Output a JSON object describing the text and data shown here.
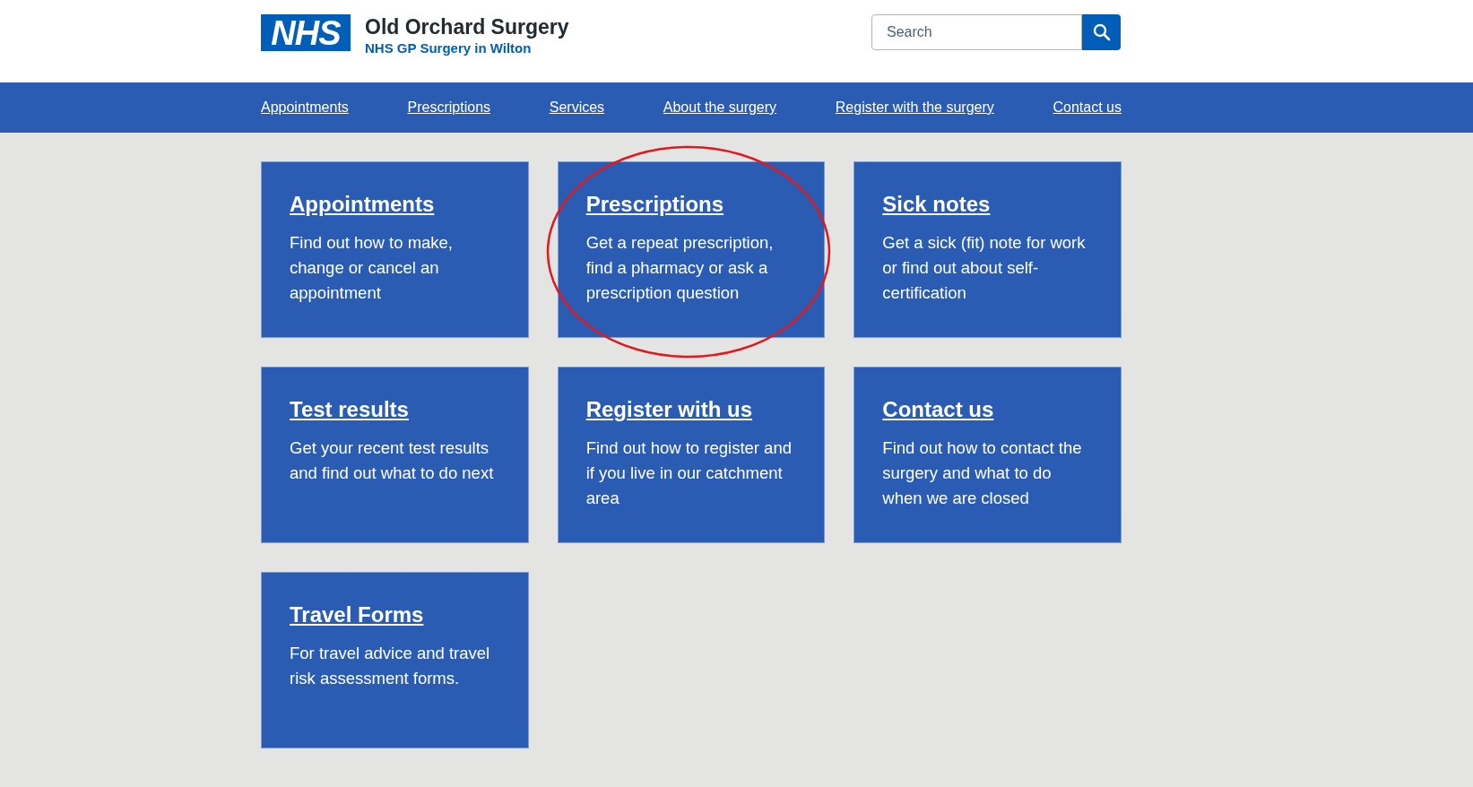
{
  "header": {
    "logo": "NHS",
    "title": "Old Orchard Surgery",
    "subtitle": "NHS GP Surgery in Wilton",
    "search": {
      "placeholder": "Search"
    }
  },
  "nav": [
    "Appointments",
    "Prescriptions",
    "Services",
    "About the surgery",
    "Register with the surgery",
    "Contact us"
  ],
  "cards": [
    {
      "title": "Appointments",
      "text": "Find out how to make, change or cancel an appointment",
      "highlighted": false
    },
    {
      "title": "Prescriptions",
      "text": "Get a repeat prescription, find a pharmacy or ask a prescription question",
      "highlighted": true
    },
    {
      "title": "Sick notes",
      "text": "Get a sick (fit) note for work or find out about self-certification",
      "highlighted": false
    },
    {
      "title": "Test results",
      "text": "Get your recent test results and find out what to do next",
      "highlighted": false
    },
    {
      "title": "Register with us",
      "text": "Find out how to register and if you live in our catchment area",
      "highlighted": false
    },
    {
      "title": "Contact us",
      "text": "Find out how to contact the surgery and what to do when we are closed",
      "highlighted": false
    },
    {
      "title": "Travel Forms",
      "text": "For travel advice and travel risk assessment forms.",
      "highlighted": false
    }
  ]
}
